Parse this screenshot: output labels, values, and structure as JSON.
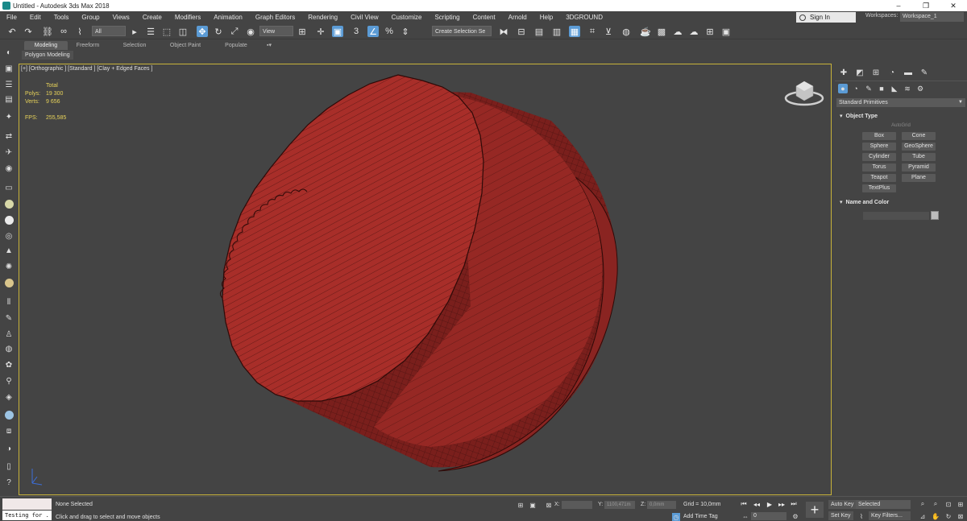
{
  "window": {
    "title": "Untitled - Autodesk 3ds Max 2018",
    "minimize": "–",
    "maximize": "❐",
    "close": "✕"
  },
  "menu": {
    "items": [
      "File",
      "Edit",
      "Tools",
      "Group",
      "Views",
      "Create",
      "Modifiers",
      "Animation",
      "Graph Editors",
      "Rendering",
      "Civil View",
      "Customize",
      "Scripting",
      "Content",
      "Arnold",
      "Help",
      "3DGROUND"
    ],
    "signin": "Sign In",
    "workspaces_label": "Workspaces:",
    "workspace_value": "Workspace_1"
  },
  "toolbar": {
    "filter": "All",
    "view_dropdown": "View",
    "selection_set": "Create Selection Se"
  },
  "ribbon": {
    "tabs": [
      "Modeling",
      "Freeform",
      "Selection",
      "Object Paint",
      "Populate"
    ],
    "panel_label": "Polygon Modeling"
  },
  "viewport": {
    "label": "[+] [Orthographic ] [Standard ] [Clay + Edged Faces ]",
    "stats": {
      "total_label": "Total",
      "polys_label": "Polys:",
      "polys_value": "19 300",
      "verts_label": "Verts:",
      "verts_value": "9 656",
      "fps_label": "FPS:",
      "fps_value": "255,585"
    },
    "mesh_color": "#9b2a26",
    "frame_color": "#c8b33a"
  },
  "command_panel": {
    "dropdown": "Standard Primitives",
    "object_type_title": "Object Type",
    "autogrid": "AutoGrid",
    "buttons": [
      "Box",
      "Cone",
      "Sphere",
      "GeoSphere",
      "Cylinder",
      "Tube",
      "Torus",
      "Pyramid",
      "Teapot",
      "Plane",
      "TextPlus"
    ],
    "name_color_title": "Name and Color"
  },
  "status": {
    "script_text": "Testing for .",
    "selection": "None Selected",
    "prompt": "Click and drag to select and move objects",
    "x_label": "X:",
    "y_label": "Y:",
    "y_value": "1100,471m",
    "z_label": "Z:",
    "z_value": "0,0mm",
    "grid": "Grid = 10,0mm",
    "add_time_tag": "Add Time Tag",
    "frame": "0",
    "auto_key": "Auto Key",
    "set_key": "Set Key",
    "selected": "Selected",
    "key_filters": "Key Filters..."
  }
}
